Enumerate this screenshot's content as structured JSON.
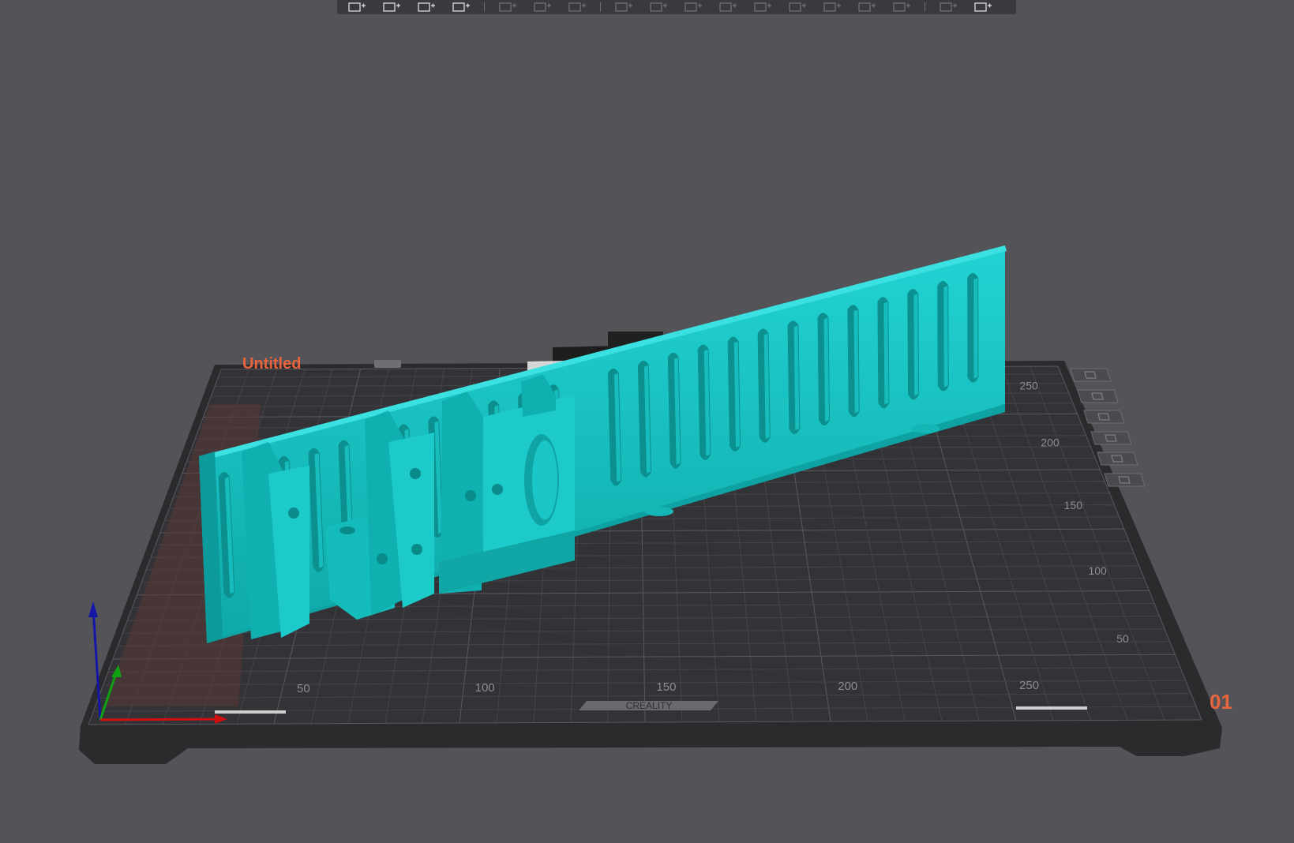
{
  "toolbar": {
    "buttons": [
      {
        "name": "add-object-button",
        "icon": "cube-add-icon",
        "enabled": true
      },
      {
        "name": "add-plate-button",
        "icon": "grid-add-icon",
        "enabled": true
      },
      {
        "name": "auto-arrange-button",
        "icon": "arrange-icon",
        "enabled": true
      },
      {
        "name": "layout-button",
        "icon": "frame-icon",
        "enabled": true
      },
      {
        "name": "copy-button",
        "icon": "copy-icon",
        "enabled": false
      },
      {
        "name": "paste-button",
        "icon": "paste-icon",
        "enabled": false
      },
      {
        "name": "layers-button",
        "icon": "layers-icon",
        "enabled": false
      },
      {
        "name": "move-button",
        "icon": "move-icon",
        "enabled": false
      },
      {
        "name": "rotate-button",
        "icon": "rotate-icon",
        "enabled": false
      },
      {
        "name": "scale-button",
        "icon": "scale-icon",
        "enabled": false
      },
      {
        "name": "lay-flat-button",
        "icon": "lay-flat-icon",
        "enabled": false
      },
      {
        "name": "cut-button",
        "icon": "cut-icon",
        "enabled": false
      },
      {
        "name": "support-paint-button",
        "icon": "support-paint-icon",
        "enabled": false
      },
      {
        "name": "seam-paint-button",
        "icon": "seam-paint-icon",
        "enabled": false
      },
      {
        "name": "measure-button",
        "icon": "measure-icon",
        "enabled": false
      },
      {
        "name": "hollow-button",
        "icon": "hollow-icon",
        "enabled": false
      },
      {
        "name": "text-button",
        "icon": "text-icon",
        "enabled": false
      },
      {
        "name": "assembly-button",
        "icon": "assembly-icon",
        "enabled": true
      }
    ]
  },
  "plate": {
    "project_name": "Untitled",
    "plate_number": "01",
    "brand_label": "CREALITY",
    "x_axis_labels": [
      "50",
      "100",
      "150",
      "200",
      "250"
    ],
    "y_axis_labels": [
      "50",
      "100",
      "150",
      "200",
      "250"
    ],
    "side_buttons": [
      {
        "name": "plate-delete-button",
        "icon": "close-icon"
      },
      {
        "name": "plate-arrange-button",
        "icon": "arrange-icon"
      },
      {
        "name": "plate-orient-button",
        "icon": "orient-icon"
      },
      {
        "name": "plate-lock-button",
        "icon": "lock-icon"
      },
      {
        "name": "plate-settings-button",
        "icon": "settings-icon"
      },
      {
        "name": "plate-slice-button",
        "icon": "upload-icon"
      }
    ]
  },
  "colors": {
    "background": "#535358",
    "plate": "#2f2f32",
    "grid": "#46464b",
    "model": "#18c2c2",
    "accent": "#e8643c",
    "x_axis": "#d01010",
    "y_axis": "#10a010",
    "z_axis": "#1515a8"
  }
}
